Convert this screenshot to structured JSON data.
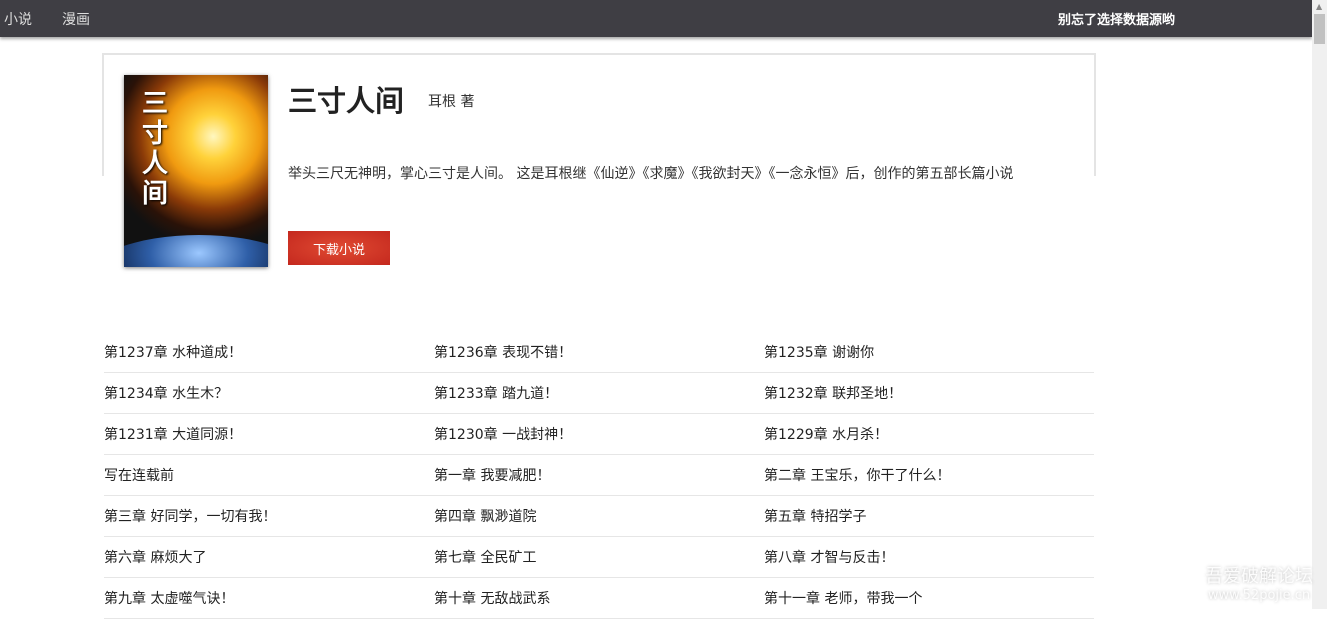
{
  "nav": {
    "items": [
      "小说",
      "漫画"
    ],
    "hint": "别忘了选择数据源哟"
  },
  "book": {
    "cover_text": "三寸人间",
    "title": "三寸人间",
    "author": "耳根 著",
    "description": "举头三尺无神明，掌心三寸是人间。 这是耳根继《仙逆》《求魔》《我欲封天》《一念永恒》后，创作的第五部长篇小说",
    "download_label": "下载小说"
  },
  "chapters": [
    [
      "第1237章 水种道成！",
      "第1236章 表现不错！",
      "第1235章 谢谢你"
    ],
    [
      "第1234章 水生木？",
      "第1233章 踏九道！",
      "第1232章 联邦圣地！"
    ],
    [
      "第1231章 大道同源！",
      "第1230章 一战封神！",
      "第1229章 水月杀！"
    ],
    [
      "写在连载前",
      "第一章 我要减肥！",
      "第二章 王宝乐，你干了什么！"
    ],
    [
      "第三章 好同学，一切有我！",
      "第四章 飘渺道院",
      "第五章 特招学子"
    ],
    [
      "第六章 麻烦大了",
      "第七章 全民矿工",
      "第八章 才智与反击！"
    ],
    [
      "第九章 太虚噬气诀！",
      "第十章 无敌战武系",
      "第十一章 老师，带我一个"
    ]
  ],
  "watermark": {
    "name": "吾爱破解论坛",
    "url": "www.52pojie.cn"
  }
}
